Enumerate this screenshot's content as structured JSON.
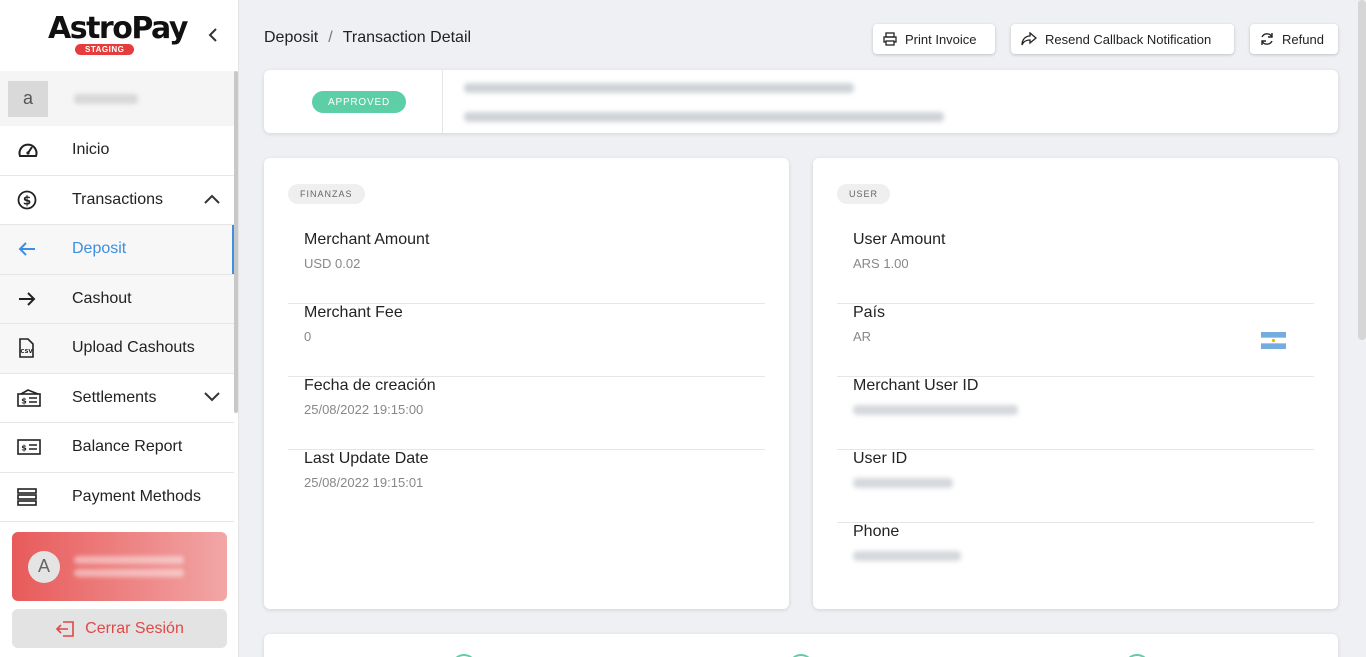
{
  "brand": {
    "name": "AstroPay",
    "env_badge": "STAGING"
  },
  "sidebar": {
    "user_initial": "a",
    "items": [
      {
        "label": "Inicio",
        "icon": "dashboard-gauge-icon"
      },
      {
        "label": "Transactions",
        "icon": "dollar-circle-icon",
        "expanded": true
      },
      {
        "label": "Deposit",
        "icon": "arrow-left-icon",
        "active": true
      },
      {
        "label": "Cashout",
        "icon": "arrow-right-icon"
      },
      {
        "label": "Upload Cashouts",
        "icon": "csv-file-icon"
      },
      {
        "label": "Settlements",
        "icon": "settlements-icon",
        "expanded": false
      },
      {
        "label": "Balance Report",
        "icon": "balance-card-icon"
      },
      {
        "label": "Payment Methods",
        "icon": "server-stack-icon"
      }
    ],
    "account_initial": "A",
    "logout_label": "Cerrar Sesión"
  },
  "breadcrumb": {
    "parent": "Deposit",
    "separator": "/",
    "current": "Transaction Detail"
  },
  "actions": {
    "print": "Print Invoice",
    "resend": "Resend Callback Notification",
    "refund": "Refund"
  },
  "status": {
    "label": "APPROVED",
    "color": "#5ccfa6"
  },
  "finanzas": {
    "chip": "FINANZAS",
    "fields": [
      {
        "label": "Merchant Amount",
        "value": "USD  0.02"
      },
      {
        "label": "Merchant Fee",
        "value": "0"
      },
      {
        "label": "Fecha de creación",
        "value": "25/08/2022 19:15:00"
      },
      {
        "label": "Last Update Date",
        "value": "25/08/2022 19:15:01"
      }
    ]
  },
  "user": {
    "chip": "USER",
    "fields": [
      {
        "label": "User Amount",
        "value": "ARS  1.00"
      },
      {
        "label": "País",
        "value": "AR"
      },
      {
        "label": "Merchant User ID"
      },
      {
        "label": "User ID"
      },
      {
        "label": "Phone"
      }
    ]
  },
  "colors": {
    "accent": "#3d8fe0",
    "danger": "#e04848",
    "success": "#5ccfa6"
  }
}
